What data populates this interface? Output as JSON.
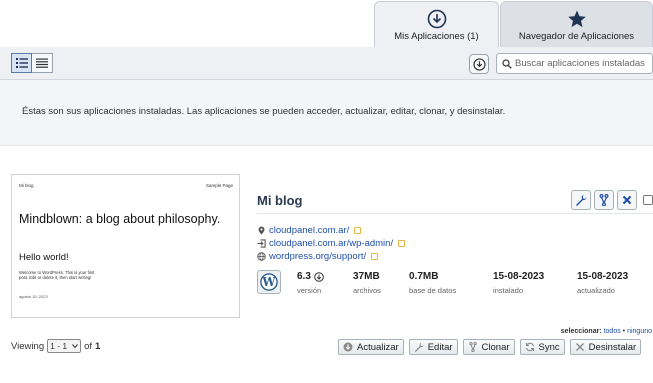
{
  "tabs": [
    {
      "label": "Mis Aplicaciones (1)",
      "icon": "download-circle-icon",
      "active": true
    },
    {
      "label": "Navegador de Aplicaciones",
      "icon": "star-icon",
      "active": false
    }
  ],
  "toolbar": {
    "view_buttons": [
      {
        "icon": "list-view-icon",
        "active": true
      },
      {
        "icon": "compact-list-icon",
        "active": false
      }
    ],
    "search_placeholder": "Buscar aplicaciones instaladas"
  },
  "banner": {
    "text": "Éstas son sus aplicaciones instaladas. Las aplicaciones se pueden acceder, actualizar, editar, clonar, y desinstalar."
  },
  "thumbnail": {
    "site_title": "Mi blog",
    "nav_link": "Sample Page",
    "heading": "Mindblown: a blog about philosophy.",
    "post_title": "Hello world!",
    "post_excerpt": "Welcome to WordPress. This is your first post. Edit or delete it, then start writing!",
    "post_date": "agosto 15, 2023"
  },
  "app": {
    "title": "Mi blog",
    "links": [
      {
        "icon": "location-pin-icon",
        "text": "cloudpanel.com.ar/"
      },
      {
        "icon": "login-icon",
        "text": "cloudpanel.com.ar/wp-admin/"
      },
      {
        "icon": "globe-icon",
        "text": "wordpress.org/support/"
      }
    ],
    "stats": [
      {
        "value": "6.3",
        "label": "versión"
      },
      {
        "value": "37MB",
        "label": "archivos"
      },
      {
        "value": "0.7MB",
        "label": "base de datos"
      },
      {
        "value": "15-08-2023",
        "label": "instalado"
      },
      {
        "value": "15-08-2023",
        "label": "actualizado"
      }
    ]
  },
  "selection": {
    "label": "seleccionar:",
    "all": "todos",
    "separator": "•",
    "none": "ninguno"
  },
  "pager": {
    "viewing_label": "Viewing",
    "range": "1 - 1",
    "of_label": "of",
    "total": "1"
  },
  "bottom_buttons": [
    {
      "label": "Actualizar",
      "icon": "download-icon"
    },
    {
      "label": "Editar",
      "icon": "wrench-icon"
    },
    {
      "label": "Clonar",
      "icon": "clone-icon"
    },
    {
      "label": "Sync",
      "icon": "sync-icon"
    },
    {
      "label": "Desinstalar",
      "icon": "close-icon"
    }
  ]
}
